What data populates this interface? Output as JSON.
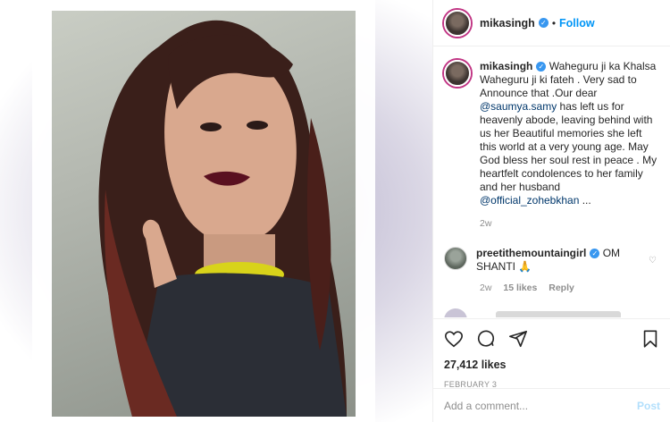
{
  "header": {
    "username": "mikasingh",
    "separator": "•",
    "follow_label": "Follow"
  },
  "caption": {
    "username": "mikasingh",
    "text_1": "Waheguru ji ka Khalsa Waheguru ji ki fateh . Very sad to Announce that .Our dear ",
    "mention_1": "@saumya.samy",
    "text_2": " has left us for heavenly abode, leaving behind with us her Beautiful memories she left this world at a very young age. May God bless her soul rest in peace . My heartfelt condolences to her family and her husband ",
    "mention_2": "@official_zohebkhan",
    "text_3": " ...",
    "time": "2w"
  },
  "comment": {
    "username": "preetithemountaingirl",
    "text": "OM SHANTI 🙏",
    "time": "2w",
    "likes": "15 likes",
    "reply": "Reply"
  },
  "actions": {
    "likes": "27,412 likes",
    "date": "FEBRUARY 3"
  },
  "add_comment": {
    "placeholder": "Add a comment...",
    "post_label": "Post"
  },
  "icons": [
    "verified-badge-icon",
    "heart-icon",
    "comment-icon",
    "share-icon",
    "bookmark-icon"
  ],
  "colors": {
    "link": "#0095f6",
    "mention": "#00376b",
    "verified": "#3897f0",
    "muted": "#8e8e8e"
  }
}
